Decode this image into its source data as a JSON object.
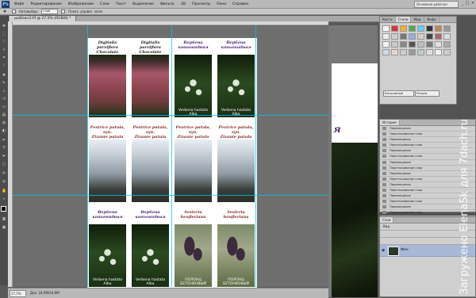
{
  "menubar": {
    "logo": "Ps",
    "items": [
      "Файл",
      "Редактирование",
      "Изображение",
      "Слои",
      "Текст",
      "Выделение",
      "Фильтр",
      "3D",
      "Просмотр",
      "Окно",
      "Справка"
    ],
    "workspace": "Основная рабочая среда",
    "minimize": "_",
    "maximize": "□",
    "close": "×"
  },
  "options": {
    "autoselect_label": "Автовыбор:",
    "autoselect_value": "Слой",
    "controls_label": "Показ. управл. элем."
  },
  "document": {
    "tab_title": "шаблон3.tif @ 27,5% (RGB/8) *"
  },
  "cards": [
    {
      "title_line1": "Digitalis parviflora",
      "title_line2": "Chocolate",
      "caption_line1": "",
      "caption_line2": "",
      "title_color": "#222222",
      "photo": "foxglove"
    },
    {
      "title_line1": "Digitalis parviflora",
      "title_line2": "Chocolate",
      "caption_line1": "",
      "caption_line2": "",
      "title_color": "#222222",
      "photo": "foxglove"
    },
    {
      "title_line1": "Вербена",
      "title_line2": "копьевидная",
      "caption_line1": "Verbena hastata",
      "caption_line2": "Alba",
      "title_color": "#4a2472",
      "photo": "verbena"
    },
    {
      "title_line1": "Вербена",
      "title_line2": "копьевидная",
      "caption_line1": "Verbena hastata",
      "caption_line2": "Alba",
      "title_color": "#4a2472",
      "photo": "verbena"
    },
    {
      "title_line1": "Pestrice patula, syn.",
      "title_line2": "Zizanie patula",
      "caption_line1": "",
      "caption_line2": "",
      "title_color": "#8a2a2a",
      "photo": "grass"
    },
    {
      "title_line1": "Pestrice patula, syn.",
      "title_line2": "Zizanie patula",
      "caption_line1": "",
      "caption_line2": "",
      "title_color": "#8a2a2a",
      "photo": "grass"
    },
    {
      "title_line1": "Pestrice patula, syn.",
      "title_line2": "Zizanie patula",
      "caption_line1": "",
      "caption_line2": "",
      "title_color": "#8a2a2a",
      "photo": "grass"
    },
    {
      "title_line1": "Pestrice patula, syn.",
      "title_line2": "Zizanie patula",
      "caption_line1": "",
      "caption_line2": "",
      "title_color": "#8a2a2a",
      "photo": "grass"
    },
    {
      "title_line1": "Вербена",
      "title_line2": "копьевидная",
      "caption_line1": "Verbena hastata",
      "caption_line2": "Alba",
      "title_color": "#4a2472",
      "photo": "verbena"
    },
    {
      "title_line1": "Вербена",
      "title_line2": "копьевидная",
      "caption_line1": "Verbena hastata",
      "caption_line2": "Alba",
      "title_color": "#4a2472",
      "photo": "verbena"
    },
    {
      "title_line1": "Sesleria",
      "title_line2": "heufleriana",
      "caption_line1": "",
      "caption_line2": "ПОЛОНЦ БЕТОНКОВЫЙ",
      "title_color": "#8a2a2a",
      "photo": "sesleria"
    },
    {
      "title_line1": "Sesleria",
      "title_line2": "heufleriana",
      "caption_line1": "",
      "caption_line2": "ПОЛОНЦ БЕТОНКОВЫЙ",
      "title_color": "#8a2a2a",
      "photo": "sesleria"
    }
  ],
  "status": {
    "zoom": "27,5%",
    "info": "Док: 24,9M/24,9M"
  },
  "bg_document": {
    "title_fragment": "я"
  },
  "swatches_panel": {
    "tabs": [
      "Кисти",
      "Стили",
      "Мод.",
      "Инфо"
    ],
    "blend_mode": "Бесшовный",
    "mode": "Режим"
  },
  "history_panel": {
    "title": "История",
    "rows": [
      "Перемещение",
      "Перетаскивание слоя",
      "Перемещение",
      "Перетаскивание слоя",
      "Перемещение",
      "Перетаскивание слоя",
      "Перемещение",
      "Перетаскивание слоя",
      "Перемещение",
      "Перетаскивание слоя",
      "Перемещение",
      "Перетаскивание слоя",
      "Перемещение",
      "Перетаскивание слоя",
      "Перемещение",
      "Перетаскивание слоя",
      "Перемещение",
      "Перетаскивание слоя"
    ]
  },
  "layers_panel": {
    "title": "Слои",
    "kind": "Вид",
    "layer_name": "Фон"
  },
  "watermark": "Загружено ElenaSk для 7dach.ru",
  "colors": {
    "guide": "#00c8e8",
    "workspace_bg": "#5a5a5a",
    "selected_layer": "#a9b8d6"
  }
}
